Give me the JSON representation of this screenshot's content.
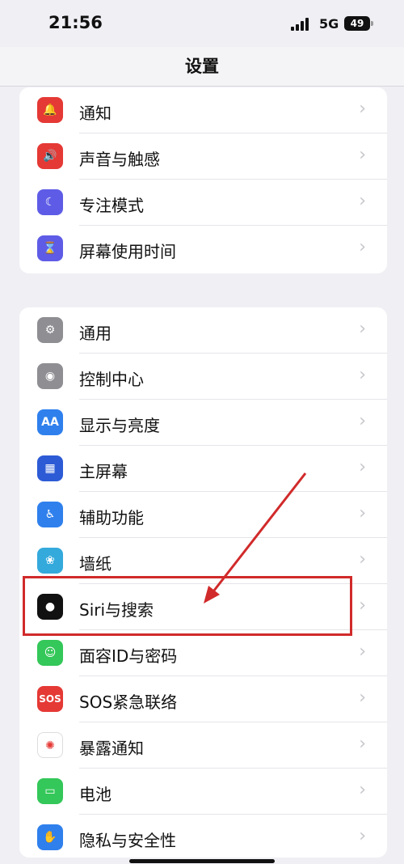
{
  "status_bar": {
    "time": "21:56",
    "network": "5G",
    "battery": "49"
  },
  "navbar": {
    "title": "设置"
  },
  "groups": [
    {
      "items": [
        {
          "label": "通知",
          "icon": "bell-icon",
          "icon_bg": "#e53935"
        },
        {
          "label": "声音与触感",
          "icon": "speaker-icon",
          "icon_bg": "#e53935"
        },
        {
          "label": "专注模式",
          "icon": "moon-icon",
          "icon_bg": "#5e5ce6"
        },
        {
          "label": "屏幕使用时间",
          "icon": "hourglass-icon",
          "icon_bg": "#5e5ce6"
        }
      ]
    },
    {
      "items": [
        {
          "label": "通用",
          "icon": "gear-icon",
          "icon_bg": "#8e8e93"
        },
        {
          "label": "控制中心",
          "icon": "toggle-icon",
          "icon_bg": "#8e8e93"
        },
        {
          "label": "显示与亮度",
          "icon": "text-size-icon",
          "icon_bg": "#2f80ed"
        },
        {
          "label": "主屏幕",
          "icon": "grid-icon",
          "icon_bg": "#2d5bd6"
        },
        {
          "label": "辅助功能",
          "icon": "accessibility-icon",
          "icon_bg": "#2f80ed"
        },
        {
          "label": "墙纸",
          "icon": "flower-icon",
          "icon_bg": "#34aadc"
        },
        {
          "label": "Siri与搜索",
          "icon": "siri-icon",
          "icon_bg": "#111111"
        },
        {
          "label": "面容ID与密码",
          "icon": "face-id-icon",
          "icon_bg": "#34c759"
        },
        {
          "label": "SOS紧急联络",
          "icon": "sos-icon",
          "icon_bg": "#e53935",
          "icon_text": "SOS"
        },
        {
          "label": "暴露通知",
          "icon": "exposure-icon",
          "icon_bg": "#ffffff"
        },
        {
          "label": "电池",
          "icon": "battery-icon",
          "icon_bg": "#34c759"
        },
        {
          "label": "隐私与安全性",
          "icon": "hand-icon",
          "icon_bg": "#2f80ed"
        }
      ]
    }
  ],
  "annotation": {
    "color": "#d12a2a",
    "target": "Siri与搜索"
  }
}
